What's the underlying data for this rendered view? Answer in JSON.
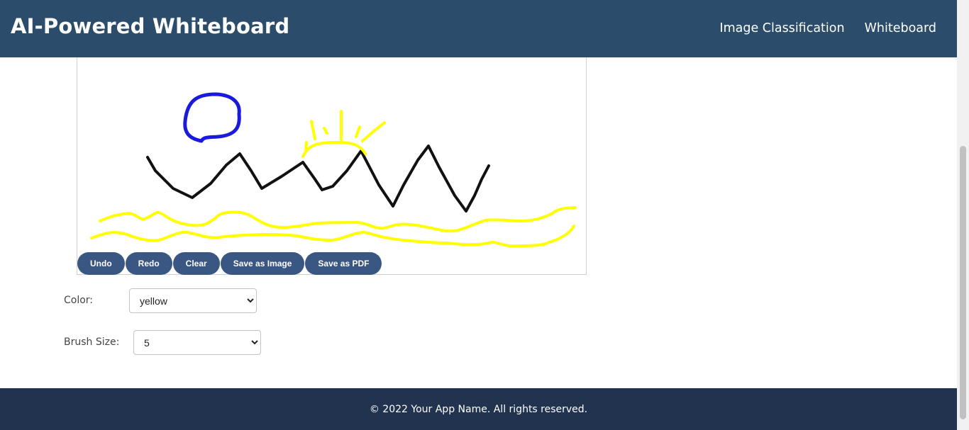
{
  "header": {
    "title": "AI-Powered Whiteboard",
    "nav": [
      {
        "label": "Image Classification"
      },
      {
        "label": "Whiteboard"
      }
    ]
  },
  "canvas": {
    "buttons": [
      {
        "label": "Undo"
      },
      {
        "label": "Redo"
      },
      {
        "label": "Clear"
      },
      {
        "label": "Save as Image"
      },
      {
        "label": "Save as PDF"
      }
    ]
  },
  "controls": {
    "color_label": "Color:",
    "color_value": "yellow",
    "brush_label": "Brush Size:",
    "brush_value": "5"
  },
  "footer": {
    "text": "© 2022 Your App Name. All rights reserved."
  },
  "colors": {
    "header_bg": "#2b4d6b",
    "footer_bg": "#223350",
    "button_bg": "#3a5683",
    "stroke_blue": "#1a1adc",
    "stroke_black": "#111111",
    "stroke_yellow": "#ffff00"
  }
}
